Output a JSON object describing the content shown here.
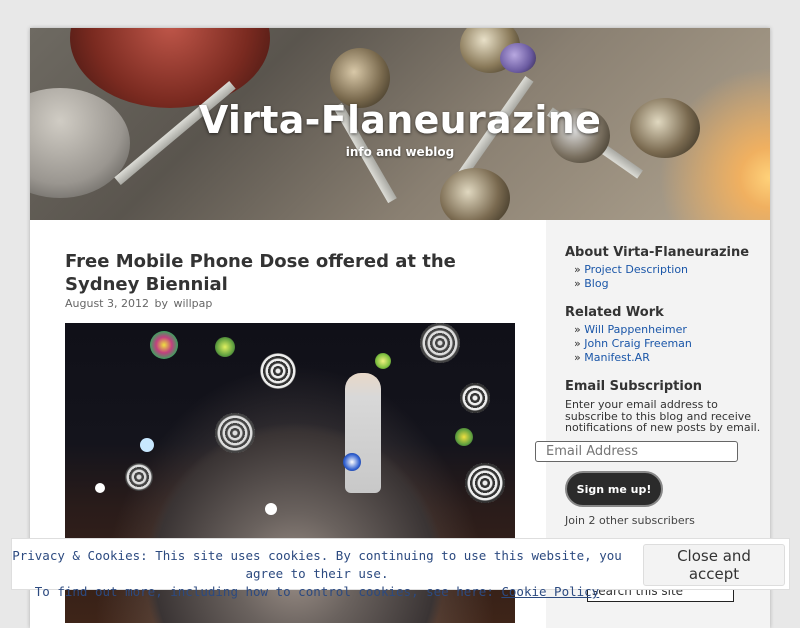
{
  "site": {
    "title": "Virta-Flaneurazine",
    "description": "info and weblog"
  },
  "post": {
    "title": "Free Mobile Phone Dose offered at the Sydney Biennial",
    "date": "August 3, 2012",
    "by": "by",
    "author": "willpap"
  },
  "sidebar": {
    "about": {
      "title": "About Virta-Flaneurazine",
      "links": [
        "Project Description",
        "Blog"
      ]
    },
    "related": {
      "title": "Related Work",
      "links": [
        "Will Pappenheimer",
        "John Craig Freeman",
        "Manifest.AR"
      ]
    },
    "subscription": {
      "title": "Email Subscription",
      "text": "Enter your email address to subscribe to this blog and receive notifications of new posts by email.",
      "email_placeholder": "Email Address",
      "button_label": "Sign me up!",
      "subscribers": "Join 2 other subscribers"
    },
    "search": {
      "value": "search this site"
    }
  },
  "cookie": {
    "line1": "Privacy & Cookies: This site uses cookies. By continuing to use this website, you agree to their use.",
    "line2_prefix": "To find out more, including how to control cookies, see here: ",
    "link_text": "Cookie Policy",
    "button_label": "Close and accept"
  },
  "bullet": "»",
  "colors": {
    "link": "#1a56a8",
    "cookie_text": "#2c4a80",
    "button_dark": "#2b2b2b"
  }
}
